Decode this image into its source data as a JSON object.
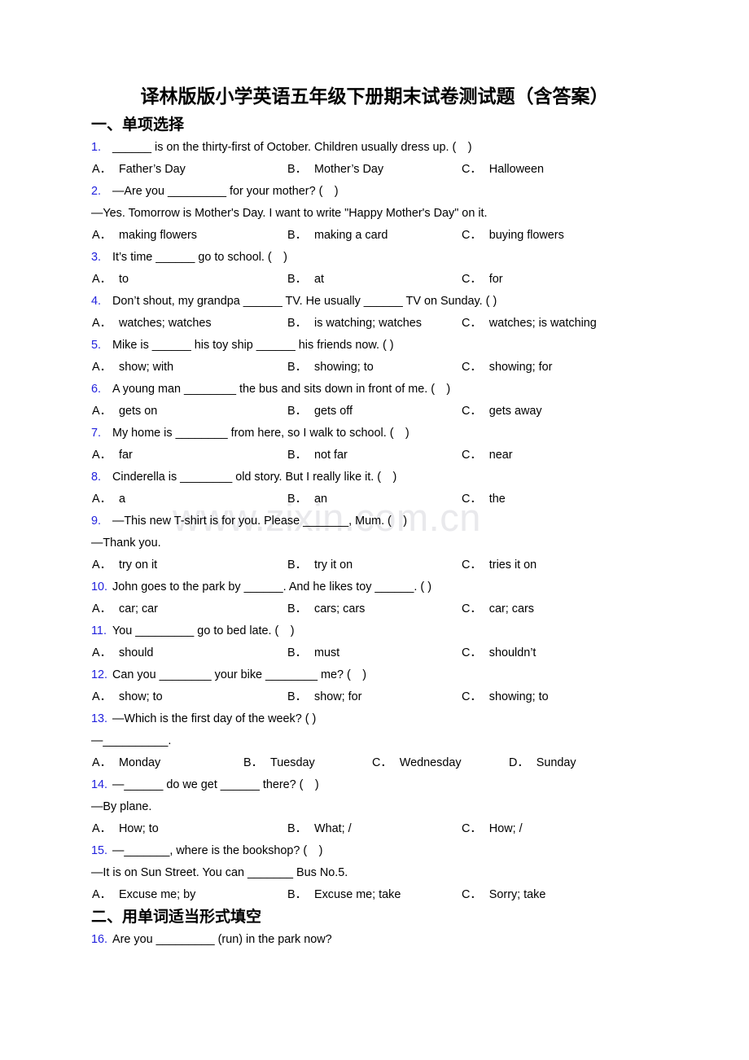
{
  "document": {
    "title": "译林版版小学英语五年级下册期末试卷测试题（含答案）",
    "watermark": "www.zixin.com.cn"
  },
  "sections": [
    {
      "id": "section-1",
      "heading": "一、单项选择"
    },
    {
      "id": "section-2",
      "heading": "二、用单词适当形式填空"
    }
  ],
  "questions": {
    "q1": {
      "num": "1.",
      "text": "______ is on the thirty-first of October. Children usually dress up. (　)"
    },
    "q1opts": {
      "a": "A．",
      "av": "Father’s Day",
      "b": "B．",
      "bv": "Mother’s Day",
      "c": "C．",
      "cv": "Halloween"
    },
    "q2": {
      "num": "2.",
      "text": "—Are you _________ for your mother? (　)"
    },
    "q2cont": "—Yes. Tomorrow is Mother's Day. I want to write \"Happy Mother's Day\" on it.",
    "q2opts": {
      "a": "A．",
      "av": "making flowers",
      "b": "B．",
      "bv": "making a card",
      "c": "C．",
      "cv": "buying flowers"
    },
    "q3": {
      "num": "3.",
      "text": "It’s time ______ go to school. (　)"
    },
    "q3opts": {
      "a": "A．",
      "av": "to",
      "b": "B．",
      "bv": "at",
      "c": "C．",
      "cv": "for"
    },
    "q4": {
      "num": "4.",
      "text": "Don’t shout, my grandpa ______ TV. He usually ______ TV on Sunday. ( )"
    },
    "q4opts": {
      "a": "A．",
      "av": "watches; watches",
      "b": "B．",
      "bv": "is watching; watches",
      "c": "C．",
      "cv": "watches; is watching"
    },
    "q5": {
      "num": "5.",
      "text": "Mike is ______ his toy ship ______ his friends now. ( )"
    },
    "q5opts": {
      "a": "A．",
      "av": "show; with",
      "b": "B．",
      "bv": "showing; to",
      "c": "C．",
      "cv": "showing; for"
    },
    "q6": {
      "num": "6.",
      "text": "A young man ________ the bus and sits down in front of me. (　)"
    },
    "q6opts": {
      "a": "A．",
      "av": "gets on",
      "b": "B．",
      "bv": "gets off",
      "c": "C．",
      "cv": "gets away"
    },
    "q7": {
      "num": "7.",
      "text": "My home is ________ from here, so I walk to school. (　)"
    },
    "q7opts": {
      "a": "A．",
      "av": "far",
      "b": "B．",
      "bv": "not far",
      "c": "C．",
      "cv": "near"
    },
    "q8": {
      "num": "8.",
      "text": "Cinderella is ________ old story. But I really like it. (　)"
    },
    "q8opts": {
      "a": "A．",
      "av": "a",
      "b": "B．",
      "bv": "an",
      "c": "C．",
      "cv": "the"
    },
    "q9": {
      "num": "9.",
      "text": "—This new T-shirt is for you. Please _______, Mum. (　)"
    },
    "q9cont": "—Thank you.",
    "q9opts": {
      "a": "A．",
      "av": "try on it",
      "b": "B．",
      "bv": "try it on",
      "c": "C．",
      "cv": "tries it on"
    },
    "q10": {
      "num": "10.",
      "text": "John goes to the park by ______. And he likes toy ______. ( )"
    },
    "q10opts": {
      "a": "A．",
      "av": "car; car",
      "b": "B．",
      "bv": "cars; cars",
      "c": "C．",
      "cv": "car; cars"
    },
    "q11": {
      "num": "11.",
      "text": "You _________ go to bed late. (　)"
    },
    "q11opts": {
      "a": "A．",
      "av": "should",
      "b": "B．",
      "bv": "must",
      "c": "C．",
      "cv": "shouldn’t"
    },
    "q12": {
      "num": "12.",
      "text": "Can you ________ your bike ________ me? (　)"
    },
    "q12opts": {
      "a": "A．",
      "av": "show; to",
      "b": "B．",
      "bv": "show; for",
      "c": "C．",
      "cv": "showing; to"
    },
    "q13": {
      "num": "13.",
      "text": "—Which is the first day of the week? ( )"
    },
    "q13cont": "—__________.",
    "q13opts": {
      "a": "A．",
      "av": "Monday",
      "b": "B．",
      "bv": "Tuesday",
      "c": "C．",
      "cv": "Wednesday",
      "d": "D．",
      "dv": "Sunday"
    },
    "q14": {
      "num": "14.",
      "text": "—______ do we get ______ there? (　)"
    },
    "q14cont": "—By plane.",
    "q14opts": {
      "a": "A．",
      "av": "How; to",
      "b": "B．",
      "bv": "What; /",
      "c": "C．",
      "cv": "How; /"
    },
    "q15": {
      "num": "15.",
      "text": "—_______, where is the bookshop? (　)"
    },
    "q15cont": "—It is on Sun Street. You can _______ Bus No.5.",
    "q15opts": {
      "a": "A．",
      "av": "Excuse me; by",
      "b": "B．",
      "bv": "Excuse me; take",
      "c": "C．",
      "cv": "Sorry; take"
    },
    "q16": {
      "num": "16.",
      "text": "Are you _________ (run) in the park now?"
    }
  },
  "colors": {
    "number": "#2222dd",
    "text": "#000000",
    "watermark": "#e9e9ec"
  }
}
